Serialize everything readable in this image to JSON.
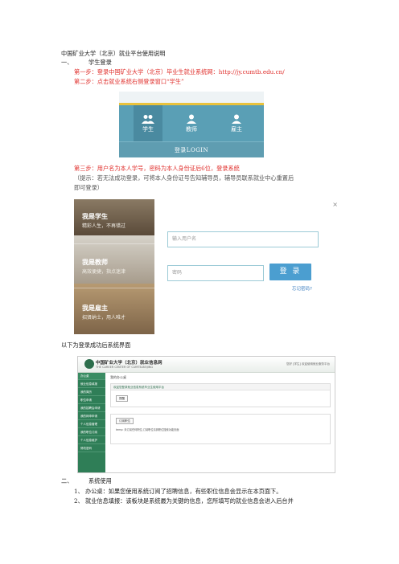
{
  "doc": {
    "title": "中国矿业大学（北京）就业平台使用说明",
    "sec1_num": "一、",
    "sec1_title": "学生登录",
    "step1": "第一步：登录中国矿业大学（北京）毕业生就业系统网：http://jy.cumtb.edu.cn/",
    "step2": "第二步：点击就业系统右侧登录窗口“学生”",
    "step3": "第三步：用户名为本人学号，密码为本人身份证后6位，登录系统",
    "hint1": "（提示：若无法成功登录，可将本人身份证号告知辅导员，辅导员联系就业中心重置后",
    "hint2": "即可登录）",
    "after_login": "以下为登录成功后系统界面",
    "sec2_num": "二、",
    "sec2_title": "系统使用",
    "item1": "1、 办公桌：如果您使用系统订阅了招聘信息，有些职位信息会显示在本页面下。",
    "item2": "2、 就业信息填报：该板块是系统最为关键的信息，您所填写的就业信息会进入后台并"
  },
  "panel1": {
    "roles": [
      "学生",
      "教师",
      "雇主"
    ],
    "login": "登录LOGIN",
    "colors": {
      "bg": "#5a9fb5",
      "accent": "#e9c23c"
    }
  },
  "panel2": {
    "blocks": [
      {
        "title": "我是学生",
        "sub": "精彩人生，不再错过"
      },
      {
        "title": "我是教师",
        "sub": "高效便捷，指点迷津"
      },
      {
        "title": "我是雇主",
        "sub": "招贤纳士，用人唯才"
      }
    ]
  },
  "loginbox": {
    "close": "×",
    "username_placeholder": "输入用户名",
    "password_placeholder": "密码",
    "login_button": "登 录",
    "forgot": "忘记密码?"
  },
  "sys": {
    "logo_title": "中国矿业大学（北京）就业信息网",
    "logo_sub": "THE CAREER CENTER OF CUMTB-BEIJING",
    "user": "您好 [学生] 欢迎使用就业服务平台",
    "sidebar": [
      "办公桌",
      "就业信息填报",
      "我的简历",
      "职位申请",
      "我的招聘会申请",
      "我的网申申请",
      "个人信息管理",
      "我的职位订阅",
      "个人信息维护",
      "修改密码"
    ],
    "crumb": "我的办公桌",
    "box1_head": "欢迎您登录就业信息系统毕业生使用平台",
    "box1_tab": "提醒",
    "box2_tab": "订阅职位",
    "box2_note": "temp: 未订阅任何职位,订阅职位请到职位搜索功能页面"
  }
}
